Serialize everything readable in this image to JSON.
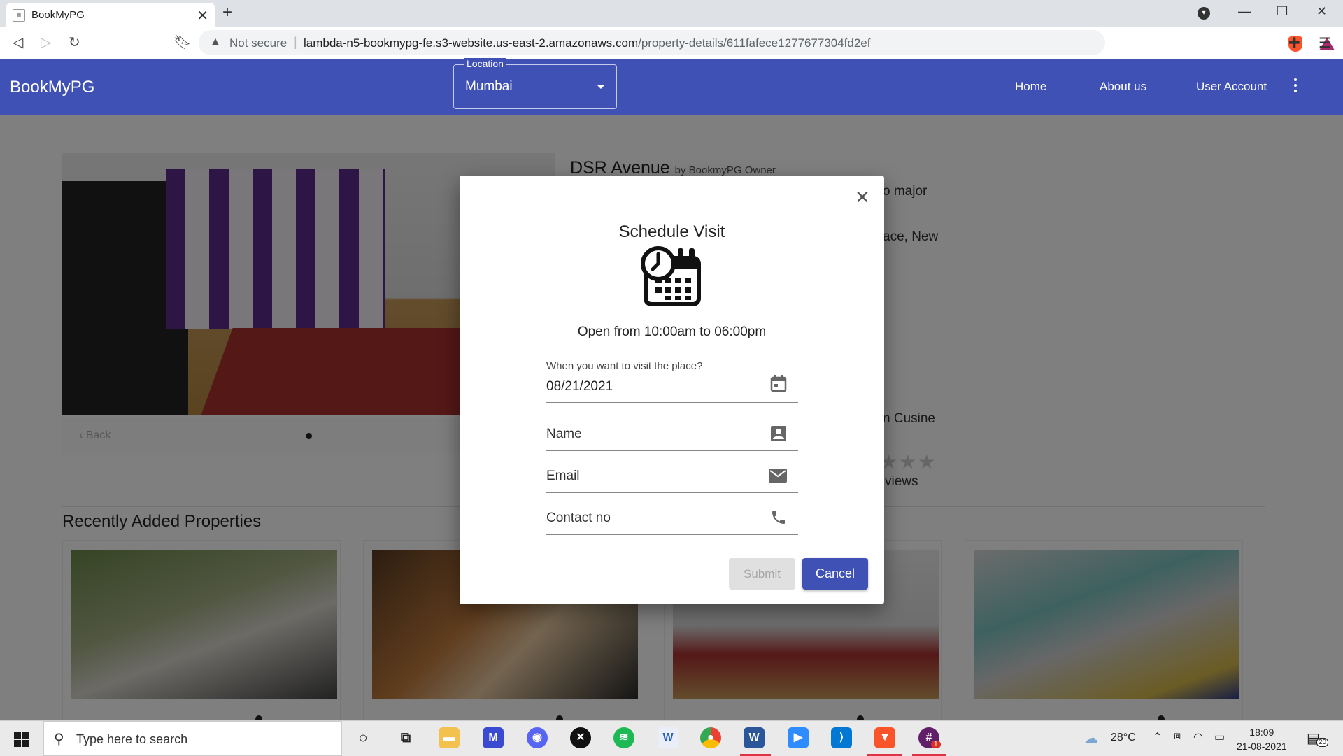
{
  "browser": {
    "tab_title": "BookMyPG",
    "not_secure": "Not secure",
    "url_host": "lambda-n5-bookmypg-fe.s3-website.us-east-2.amazonaws.com",
    "url_path": "/property-details/611fafece1277677304fd2ef"
  },
  "header": {
    "brand": "BookMyPG",
    "location_label": "Location",
    "location_value": "Mumbai",
    "nav": [
      "Home",
      "About us",
      "User Account"
    ]
  },
  "property": {
    "name": "DSR Avenue",
    "owner": "by BookmyPG Owner",
    "fragments": [
      "o major",
      "ace, New",
      "n Cusine",
      "views"
    ],
    "back_label": "Back"
  },
  "recent": {
    "title": "Recently Added Properties"
  },
  "dialog": {
    "title": "Schedule Visit",
    "hours": "Open from 10:00am to 06:00pm",
    "date_label": "When you want to visit the place?",
    "date_value": "08/21/2021",
    "name_placeholder": "Name",
    "email_placeholder": "Email",
    "contact_placeholder": "Contact no",
    "submit_label": "Submit",
    "cancel_label": "Cancel"
  },
  "taskbar": {
    "search_placeholder": "Type here to search",
    "temperature": "28°C",
    "time": "18:09",
    "date": "21-08-2021",
    "notification_count": "20",
    "slack_badge": "1"
  },
  "colors": {
    "primary": "#3f51b5",
    "overlay": "rgba(0,0,0,0.5)"
  }
}
